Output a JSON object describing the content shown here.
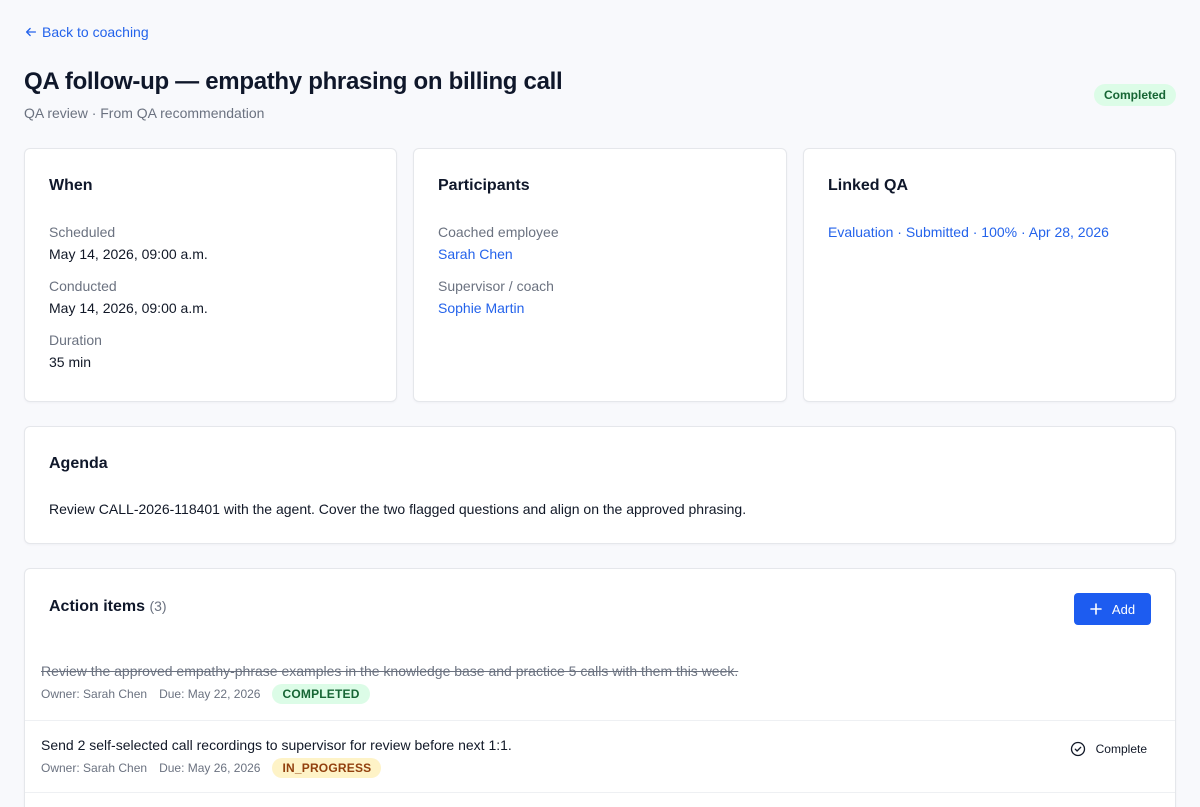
{
  "back_link": "Back to coaching",
  "title": "QA follow-up — empathy phrasing on billing call",
  "subtitle": "QA review · From QA recommendation",
  "status": "Completed",
  "when": {
    "title": "When",
    "scheduled_label": "Scheduled",
    "scheduled_value": "May 14, 2026, 09:00 a.m.",
    "conducted_label": "Conducted",
    "conducted_value": "May 14, 2026, 09:00 a.m.",
    "duration_label": "Duration",
    "duration_value": "35 min"
  },
  "participants": {
    "title": "Participants",
    "employee_label": "Coached employee",
    "employee_name": "Sarah Chen",
    "supervisor_label": "Supervisor / coach",
    "supervisor_name": "Sophie Martin"
  },
  "linked_qa": {
    "title": "Linked QA",
    "evaluation_link": "Evaluation · Submitted · 100% · Apr 28, 2026"
  },
  "agenda": {
    "title": "Agenda",
    "text": "Review CALL-2026-118401 with the agent. Cover the two flagged questions and align on the approved phrasing."
  },
  "actions": {
    "title": "Action items",
    "count": "(3)",
    "add_label": "Add",
    "items": [
      {
        "text": "Review the approved empathy-phrase examples in the knowledge base and practice 5 calls with them this week.",
        "owner": "Owner: Sarah Chen",
        "due": "Due: May 22, 2026",
        "status": "COMPLETED"
      },
      {
        "text": "Send 2 self-selected call recordings to supervisor for review before next 1:1.",
        "owner": "Owner: Sarah Chen",
        "due": "Due: May 26, 2026",
        "status": "IN_PROGRESS",
        "complete_label": "Complete"
      }
    ]
  },
  "colors": {
    "accent": "#2463eb",
    "completed_bg": "#dcfce7",
    "in_progress_bg": "#fef3c7"
  }
}
